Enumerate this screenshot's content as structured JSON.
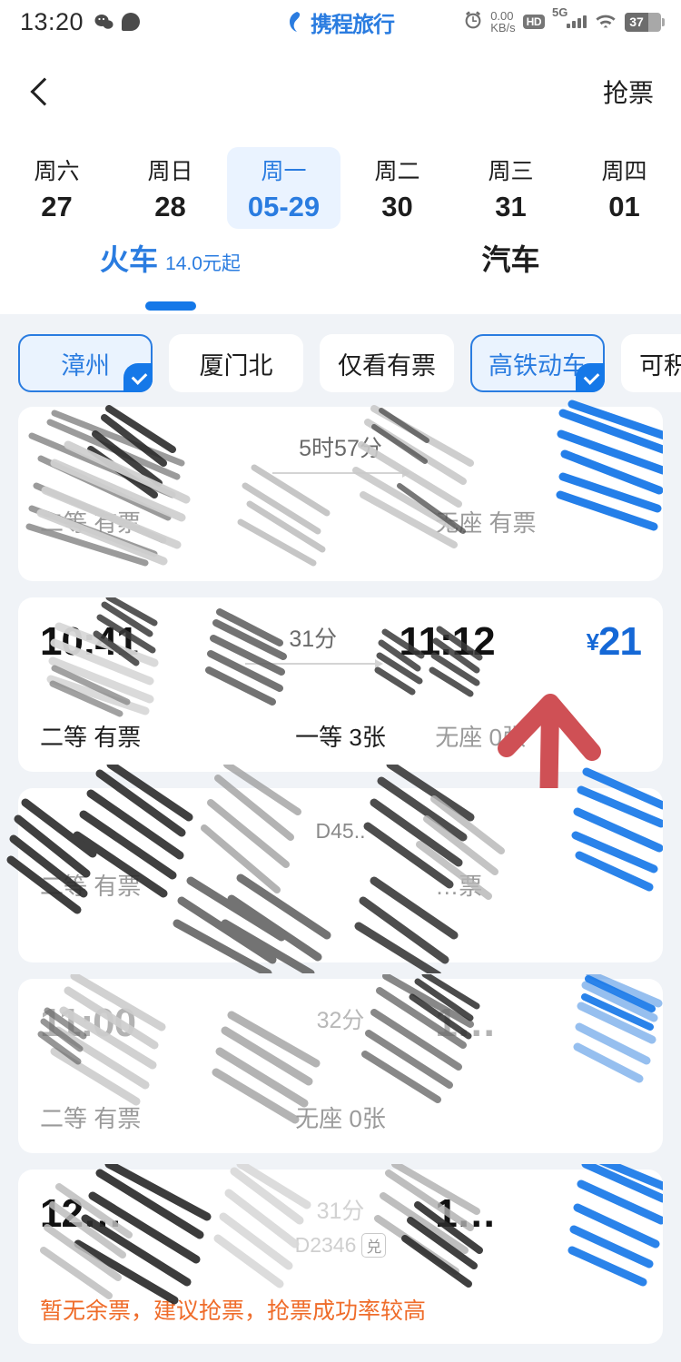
{
  "status_bar": {
    "time": "13:20",
    "wechat_icon": "wechat-icon",
    "chat_icon": "chat-bubble-icon",
    "brand": "携程旅行",
    "alarm_icon": "alarm-clock-icon",
    "net_speed_value": "0.00",
    "net_speed_unit": "KB/s",
    "hd_badge": "HD",
    "network": "5G",
    "wifi_icon": "wifi-icon",
    "battery": "37"
  },
  "nav": {
    "back_icon": "back-chevron-icon",
    "title_redacted": "",
    "right_action": "抢票"
  },
  "date_strip": {
    "dates": [
      {
        "weekday": "周六",
        "day": "27",
        "selected": false
      },
      {
        "weekday": "周日",
        "day": "28",
        "selected": false
      },
      {
        "weekday": "周一",
        "day": "05-29",
        "selected": true
      },
      {
        "weekday": "周二",
        "day": "30",
        "selected": false
      },
      {
        "weekday": "周三",
        "day": "31",
        "selected": false
      },
      {
        "weekday": "周四",
        "day": "01",
        "selected": false
      }
    ],
    "calendar_icon": "calendar-icon",
    "expand_icon": "chevron-down-icon"
  },
  "tabs": [
    {
      "label": "火车",
      "sub": "14.0元起",
      "active": true
    },
    {
      "label": "汽车",
      "sub": "",
      "active": false
    }
  ],
  "filters": [
    {
      "label": "漳州",
      "selected": true
    },
    {
      "label": "厦门北",
      "selected": false
    },
    {
      "label": "仅看有票",
      "selected": false
    },
    {
      "label": "高铁动车",
      "selected": true
    },
    {
      "label": "可积分兑",
      "selected": false
    }
  ],
  "trains": [
    {
      "depart": "",
      "depart_station": "",
      "duration": "5时57分",
      "train_no": "",
      "arrive": "",
      "arrive_station": "",
      "price": "",
      "seats": [
        "二等 有票",
        "",
        "无座 有票"
      ],
      "redacted": true
    },
    {
      "depart": "10:41",
      "depart_station": "",
      "duration": "31分",
      "train_no": "",
      "arrive": "11:12",
      "arrive_station": "",
      "price": "21",
      "currency": "¥",
      "seats": [
        "二等 有票",
        "一等 3张",
        "无座 0张"
      ],
      "redacted": false
    },
    {
      "depart": "",
      "depart_station": "",
      "duration": "",
      "train_no": "D45..",
      "arrive": "",
      "arrive_station": "",
      "price": "",
      "seats": [
        "二等 有票",
        "",
        "…票"
      ],
      "redacted": true
    },
    {
      "depart": "11:00",
      "depart_station": "",
      "duration": "32分",
      "train_no": "",
      "arrive": "1…",
      "arrive_station": "",
      "price": "",
      "seats": [
        "二等 有票",
        "无座 0张",
        ""
      ],
      "redacted": true
    },
    {
      "depart": "12…",
      "depart_station": "",
      "duration": "31分",
      "train_no": "D2346",
      "train_badge": "兑",
      "arrive": "1…",
      "arrive_station": "",
      "price": "",
      "warning": "暂无余票，建议抢票，抢票成功率较高",
      "seats": [],
      "redacted": true
    }
  ],
  "annotation": {
    "arrow_color": "#cf5055",
    "arrow_name": "red-annotation-arrow",
    "points_to": "price of 10:41 train"
  },
  "colors": {
    "accent_blue": "#1578e8",
    "price_blue": "#1568d6",
    "warning_orange": "#ef6c2a",
    "list_bg": "#f0f3f7",
    "card_bg": "#ffffff"
  }
}
